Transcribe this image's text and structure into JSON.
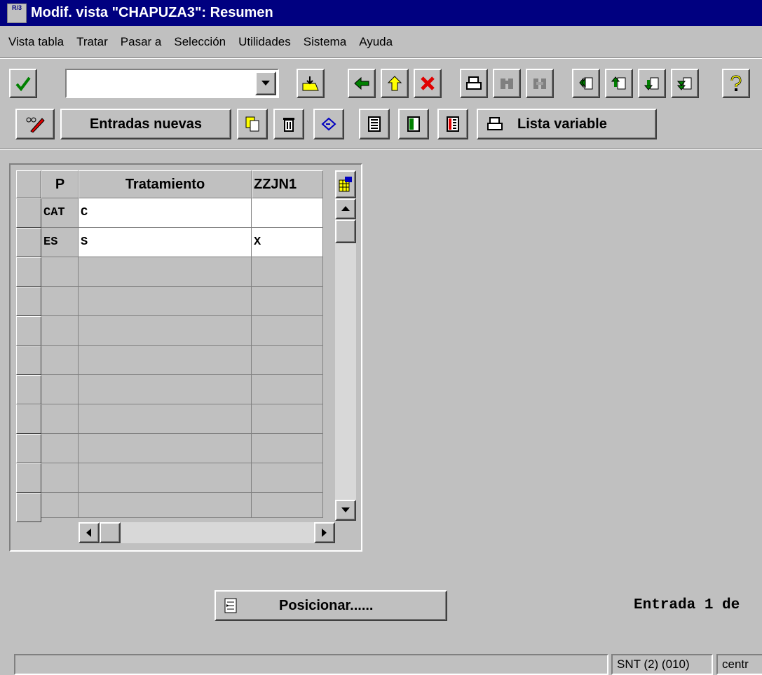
{
  "window": {
    "title": "Modif. vista \"CHAPUZA3\": Resumen",
    "icon_label": "R/3"
  },
  "menu": [
    {
      "label": "Vista tabla"
    },
    {
      "label": "Tratar"
    },
    {
      "label": "Pasar a"
    },
    {
      "label": "Selección"
    },
    {
      "label": "Utilidades"
    },
    {
      "label": "Sistema"
    },
    {
      "label": "Ayuda"
    }
  ],
  "command_field": {
    "value": ""
  },
  "app_toolbar": {
    "new_entries_label": "Entradas nuevas",
    "variable_list_label": "Lista variable"
  },
  "table": {
    "columns": [
      "P",
      "Tratamiento",
      "ZZJN1"
    ],
    "rows": [
      {
        "p": "CAT",
        "tratamiento": "C",
        "zzjn1": ""
      },
      {
        "p": "ES",
        "tratamiento": "S",
        "zzjn1": "X"
      }
    ],
    "empty_rows": 9
  },
  "position_button": {
    "label": "Posicionar......"
  },
  "entry_info": "Entrada 1 de",
  "statusbar": {
    "system": "SNT (2) (010)",
    "server": "centr"
  }
}
